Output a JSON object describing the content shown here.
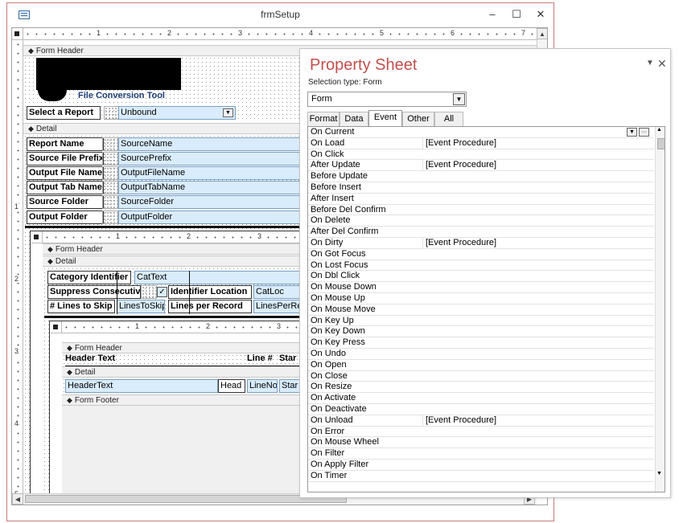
{
  "window": {
    "title": "frmSetup",
    "minimize": "–",
    "maximize": "☐",
    "close": "✕"
  },
  "ruler_main": [
    "1",
    "2",
    "3",
    "4",
    "5",
    "6",
    "7"
  ],
  "ruler_left": [
    "1",
    "2",
    "3",
    "4",
    "5"
  ],
  "main_form": {
    "header_section": "Form Header",
    "app_title": "File Conversion Tool",
    "select_label": "Select a Report",
    "select_value": "Unbound",
    "detail_section": "Detail",
    "rows": [
      {
        "label": "Report Name",
        "field": "SourceName"
      },
      {
        "label": "Source File Prefix",
        "field": "SourcePrefix"
      },
      {
        "label": "Output File Name",
        "field": "OutputFileName"
      },
      {
        "label": "Output Tab Name",
        "field": "OutputTabName"
      },
      {
        "label": "Source Folder",
        "field": "SourceFolder"
      },
      {
        "label": "Output Folder",
        "field": "OutputFolder"
      }
    ]
  },
  "subform1": {
    "ruler": [
      "1",
      "2",
      "3"
    ],
    "header_section": "Form Header",
    "detail_section": "Detail",
    "category_label": "Category Identifier",
    "category_field": "CatText",
    "suppress_label": "Suppress Consecutive",
    "check_mark": "✓",
    "idloc_label": "Identifier Location",
    "idloc_field": "CatLoc",
    "skip_label": "# Lines to Skip",
    "skip_field": "LinesToSkip",
    "lpr_label": "Lines per Record",
    "lpr_field": "LinesPerRec"
  },
  "subform2": {
    "ruler": [
      "1",
      "2",
      "3"
    ],
    "header_section": "Form Header",
    "header_text_label": "Header Text",
    "line_label": "Line #",
    "start_label": "Star",
    "detail_section": "Detail",
    "header_text_field": "HeaderText",
    "head_field": "Head",
    "lineno_field": "LineNo",
    "start_field": "Star",
    "footer_section": "Form Footer"
  },
  "property_sheet": {
    "title": "Property Sheet",
    "selection_type": "Selection type:  Form",
    "object": "Form",
    "tabs": [
      "Format",
      "Data",
      "Event",
      "Other",
      "All"
    ],
    "active_tab": "Event",
    "properties": [
      {
        "name": "On Current",
        "value": ""
      },
      {
        "name": "On Load",
        "value": "[Event Procedure]"
      },
      {
        "name": "On Click",
        "value": ""
      },
      {
        "name": "After Update",
        "value": "[Event Procedure]"
      },
      {
        "name": "Before Update",
        "value": ""
      },
      {
        "name": "Before Insert",
        "value": ""
      },
      {
        "name": "After Insert",
        "value": ""
      },
      {
        "name": "Before Del Confirm",
        "value": ""
      },
      {
        "name": "On Delete",
        "value": ""
      },
      {
        "name": "After Del Confirm",
        "value": ""
      },
      {
        "name": "On Dirty",
        "value": "[Event Procedure]"
      },
      {
        "name": "On Got Focus",
        "value": ""
      },
      {
        "name": "On Lost Focus",
        "value": ""
      },
      {
        "name": "On Dbl Click",
        "value": ""
      },
      {
        "name": "On Mouse Down",
        "value": ""
      },
      {
        "name": "On Mouse Up",
        "value": ""
      },
      {
        "name": "On Mouse Move",
        "value": ""
      },
      {
        "name": "On Key Up",
        "value": ""
      },
      {
        "name": "On Key Down",
        "value": ""
      },
      {
        "name": "On Key Press",
        "value": ""
      },
      {
        "name": "On Undo",
        "value": ""
      },
      {
        "name": "On Open",
        "value": ""
      },
      {
        "name": "On Close",
        "value": ""
      },
      {
        "name": "On Resize",
        "value": ""
      },
      {
        "name": "On Activate",
        "value": ""
      },
      {
        "name": "On Deactivate",
        "value": ""
      },
      {
        "name": "On Unload",
        "value": "[Event Procedure]"
      },
      {
        "name": "On Error",
        "value": ""
      },
      {
        "name": "On Mouse Wheel",
        "value": ""
      },
      {
        "name": "On Filter",
        "value": ""
      },
      {
        "name": "On Apply Filter",
        "value": ""
      },
      {
        "name": "On Timer",
        "value": ""
      }
    ]
  }
}
